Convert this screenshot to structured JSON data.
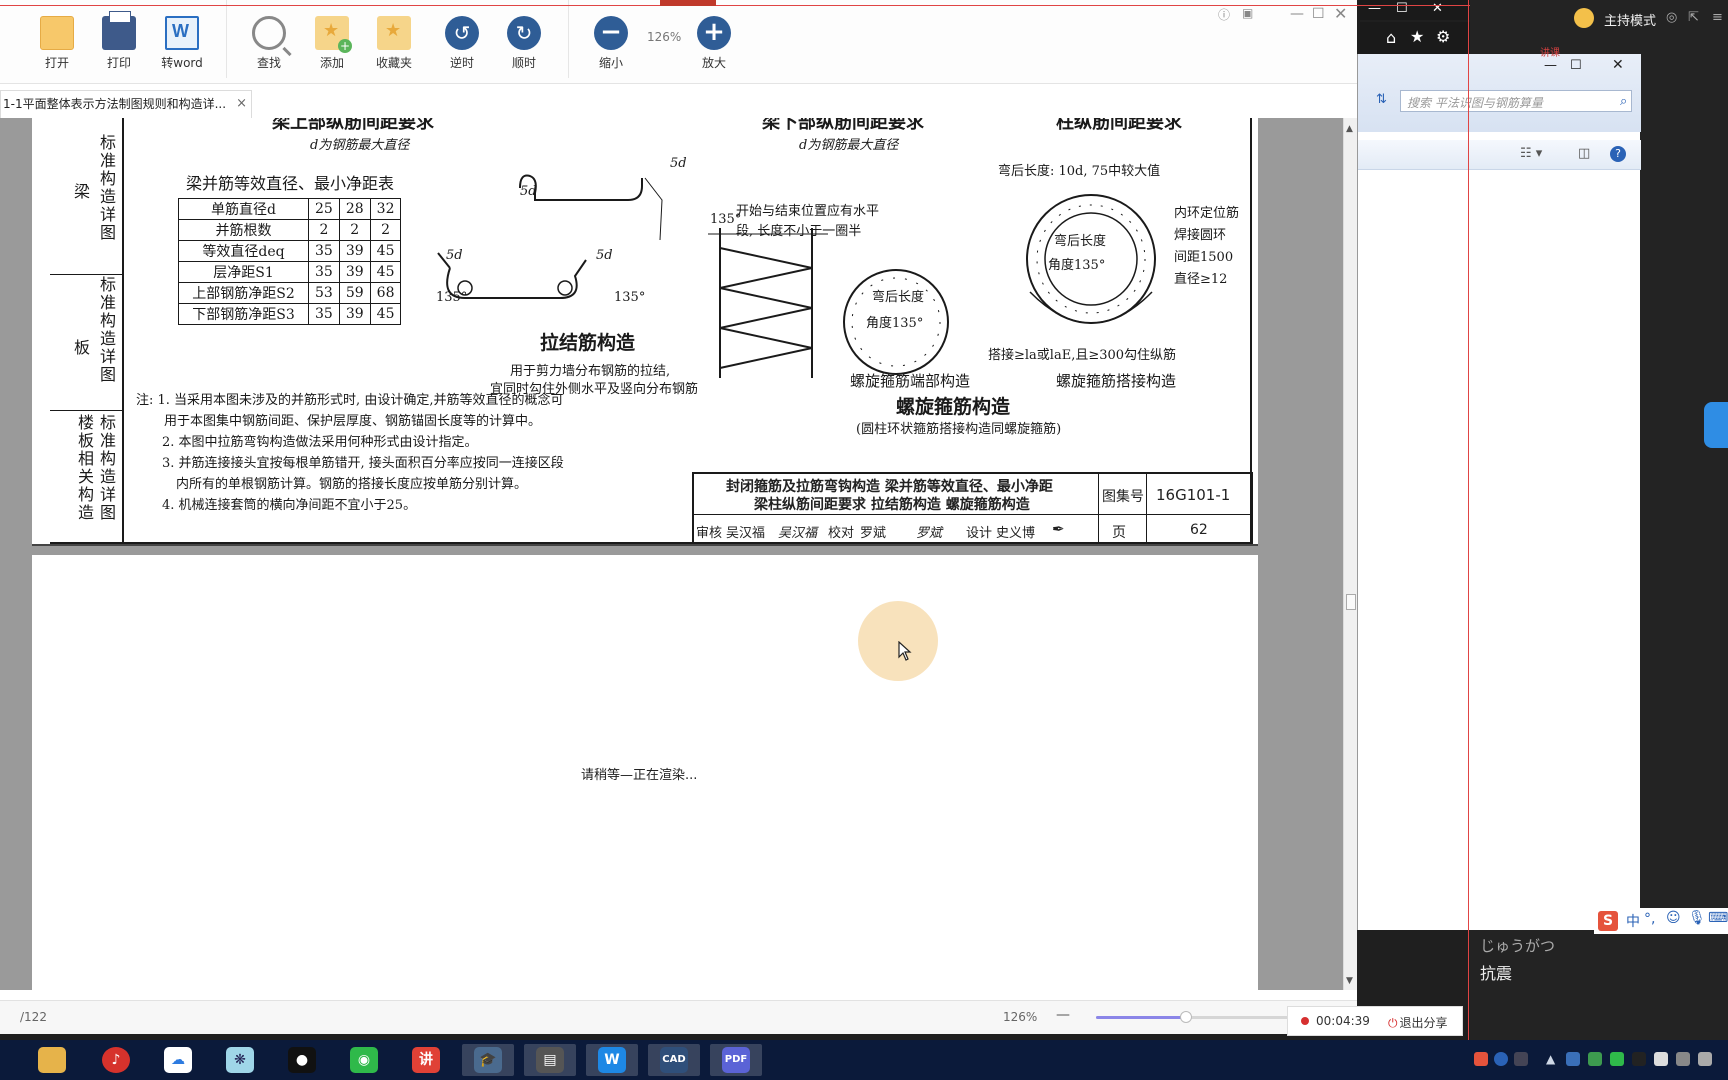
{
  "toolbar": {
    "open": "打开",
    "print": "打印",
    "to_word": "转word",
    "find": "查找",
    "add": "添加",
    "favorites": "收藏夹",
    "rotate_ccw": "逆时",
    "rotate_cw": "顺时",
    "zoom_out": "缩小",
    "zoom_value": "126%",
    "zoom_in": "放大"
  },
  "tab": {
    "title": "1-1平面整体表示方法制图规则和构造详...",
    "close": "×"
  },
  "drawing": {
    "side_beam": "梁",
    "side_beam_col": "标准构造详图",
    "side_slab": "板",
    "side_slab_col": "标准构造详图",
    "side_floor_col1": "楼板相关构造",
    "side_floor_col2": "标准构造详图",
    "beam_top_title": "梁上部纵筋间距要求",
    "beam_top_sub": "d为钢筋最大直径",
    "beam_bot_title": "梁下部纵筋间距要求",
    "beam_bot_sub": "d为钢筋最大直径",
    "col_title": "柱纵筋间距要求",
    "table_title": "梁并筋等效直径、最小净距表",
    "table_rows": [
      [
        "单筋直径d",
        "25",
        "28",
        "32"
      ],
      [
        "并筋根数",
        "2",
        "2",
        "2"
      ],
      [
        "等效直径deq",
        "35",
        "39",
        "45"
      ],
      [
        "层净距S1",
        "35",
        "39",
        "45"
      ],
      [
        "上部钢筋净距S2",
        "53",
        "59",
        "68"
      ],
      [
        "下部钢筋净距S3",
        "35",
        "39",
        "45"
      ]
    ],
    "hook_5d_a": "5d",
    "hook_5d_b": "5d",
    "hook_5d_c": "5d",
    "hook_5d_d": "5d",
    "angle_135": "135°",
    "tie_title": "拉结筋构造",
    "tie_note1": "用于剪力墙分布钢筋的拉结,",
    "tie_note2": "宜同时勾住外侧水平及竖向分布钢筋",
    "spiral_note1": "开始与结束位置应有水平",
    "spiral_note2": "段, 长度不小于一圈半",
    "bend_len": "弯后长度",
    "bend_angle": "角度135°",
    "col_bend_note": "弯后长度: 10d, 75中较大值",
    "ring_note1": "内环定位筋",
    "ring_note2": "焊接圆环",
    "ring_note3": "间距1500",
    "ring_note4": "直径≥12",
    "lap_note": "搭接≥la或laE,且≥300勾住纵筋",
    "spiral_end_caption": "螺旋箍筋端部构造",
    "spiral_lap_caption": "螺旋箍筋搭接构造",
    "spiral_title": "螺旋箍筋构造",
    "spiral_sub": "(圆柱环状箍筋搭接构造同螺旋箍筋)",
    "notes": [
      "注: 1. 当采用本图未涉及的并筋形式时, 由设计确定,并筋等效直径的概念可",
      "用于本图集中钢筋间距、保护层厚度、钢筋锚固长度等的计算中。",
      "2. 本图中拉筋弯钩构造做法采用何种形式由设计指定。",
      "3. 并筋连接接头宜按每根单筋错开, 接头面积百分率应按同一连接区段",
      "内所有的单根钢筋计算。钢筋的搭接长度应按单筋分别计算。",
      "4. 机械连接套筒的横向净间距不宜小于25。"
    ],
    "tb_line1": "封闭箍筋及拉筋弯钩构造   梁并筋等效直径、最小净距",
    "tb_line2": "梁柱纵筋间距要求   拉结筋构造   螺旋箍筋构造",
    "tb_atlas_label": "图集号",
    "tb_atlas_no": "16G101-1",
    "tb_review": "审核",
    "tb_reviewer": "吴汉福",
    "tb_reviewer_sig": "吴汉福",
    "tb_check": "校对",
    "tb_checker": "罗斌",
    "tb_checker_sig": "罗斌",
    "tb_design": "设计",
    "tb_designer": "史义博",
    "tb_page_label": "页",
    "tb_page_no": "62"
  },
  "render_message": "请稍等—正在渲染...",
  "status": {
    "page_total": "/122",
    "zoom": "126%",
    "zoom_minus": "—",
    "zoom_level": 0.45,
    "timer": "00:04:39",
    "exit_share": "退出分享"
  },
  "explorer": {
    "search_placeholder": "搜索 平法识图与钢筋算量"
  },
  "right_panel": {
    "host_mode": "主持模式",
    "ime_candidate": "じゅうがつ",
    "ime_word": "抗震",
    "ime_label": "中",
    "top_red_text": "讲课"
  },
  "taskbar": {
    "apps": [
      "file-explorer",
      "netease-music",
      "baidu-netdisk",
      "feather-app",
      "qq",
      "wechat",
      "jiang-app",
      "edu-app",
      "course-app",
      "word-app",
      "cad",
      "pdf"
    ],
    "cad_label": "CAD",
    "pdf_label": "PDF",
    "jiang_label": "讲"
  },
  "colors": {
    "accent": "#2f5d96",
    "record_dot": "#d62f2f",
    "slider": "#8b86e8",
    "taskbar": "#0b1a3a"
  }
}
